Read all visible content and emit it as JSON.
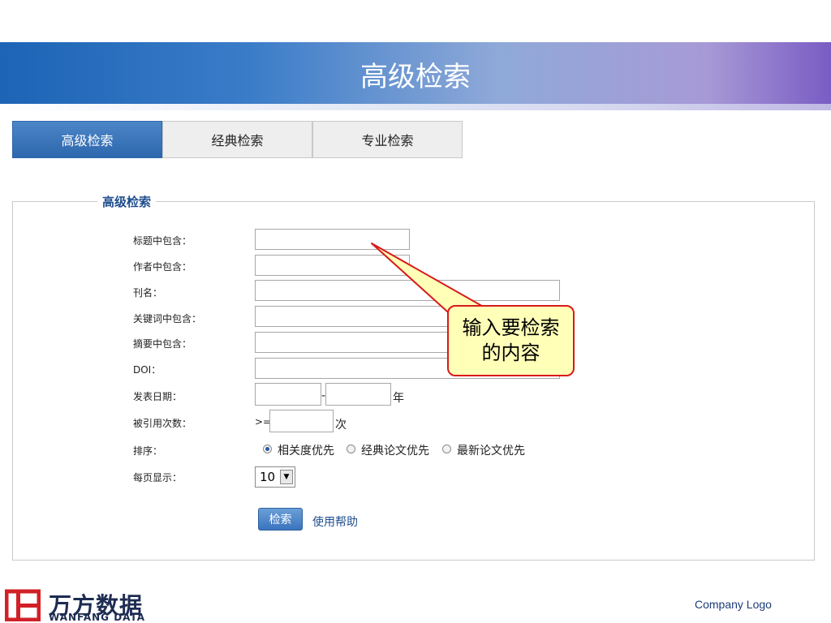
{
  "page_title": "高级检索",
  "tabs": [
    {
      "label": "高级检索",
      "active": true
    },
    {
      "label": "经典检索",
      "active": false
    },
    {
      "label": "专业检索",
      "active": false
    }
  ],
  "form": {
    "legend": "高级检索",
    "fields": [
      {
        "label": "标题中包含：",
        "value": ""
      },
      {
        "label": "作者中包含：",
        "value": ""
      },
      {
        "label": "刊名：",
        "value": ""
      },
      {
        "label": "关键词中包含：",
        "value": ""
      },
      {
        "label": "摘要中包含：",
        "value": ""
      },
      {
        "label": "DOI：",
        "value": ""
      }
    ],
    "date": {
      "label": "发表日期：",
      "from": "",
      "to": "",
      "separator": "-",
      "unit": "年"
    },
    "citations": {
      "label": "被引用次数：",
      "prefix": ">=",
      "value": "",
      "unit": "次"
    },
    "sort": {
      "label": "排序：",
      "options": [
        "相关度优先",
        "经典论文优先",
        "最新论文优先"
      ],
      "selected": 0
    },
    "per_page": {
      "label": "每页显示：",
      "value": "10"
    },
    "submit_label": "检索",
    "help_label": "使用帮助"
  },
  "callout_text": "输入要检索的内容",
  "footer": {
    "logo_cn": "万方数据",
    "logo_en": "WANFANG DATA",
    "company": "Company Logo"
  },
  "colors": {
    "accent": "#2d67ad",
    "callout_border": "#d81a1a",
    "callout_fill": "#ffffb8"
  },
  "icons": [
    "wanfang-logo-icon",
    "chevron-down-icon",
    "radio-icon"
  ]
}
